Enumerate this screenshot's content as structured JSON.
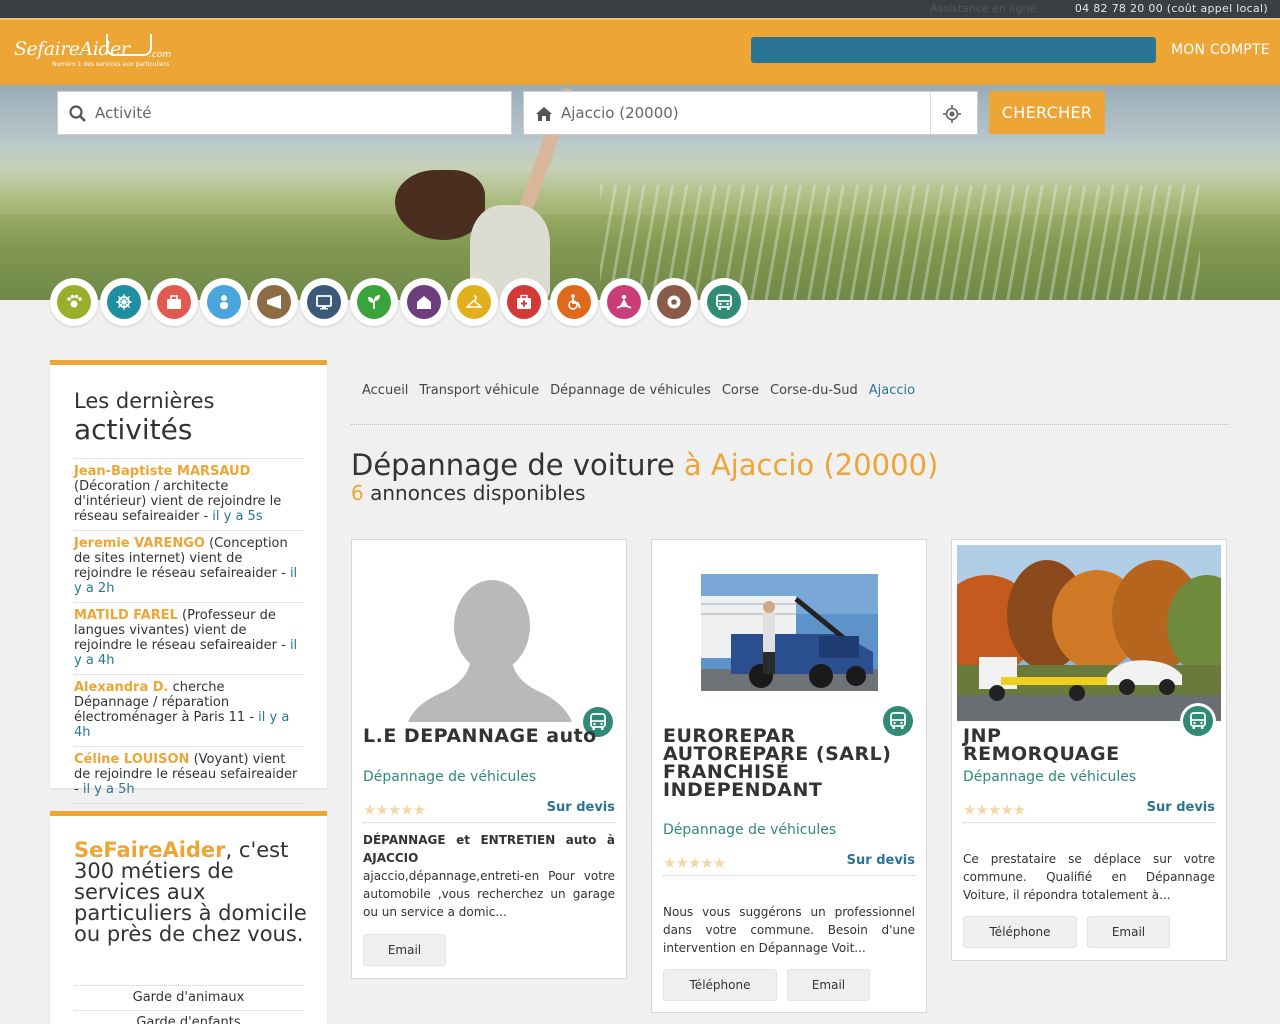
{
  "topbar": {
    "ghost_text": "Assistance en ligne",
    "phone": "04 82 78 20 00 (coût appel local)"
  },
  "header": {
    "logo_text": "SefaireAider",
    "logo_com": ".com",
    "logo_tagline": "Numéro 1 des services aux particuliers",
    "account_label": "MON COMPTE"
  },
  "search": {
    "activity_placeholder": "Activité",
    "city_value": "Ajaccio (20000)",
    "button_label": "CHERCHER"
  },
  "categories": [
    {
      "name": "animaux",
      "color": "#9bae2b",
      "icon": "paw-icon"
    },
    {
      "name": "nautisme",
      "color": "#1d8fa0",
      "icon": "helm-icon"
    },
    {
      "name": "bricolage",
      "color": "#e05a4f",
      "icon": "toolbox-icon"
    },
    {
      "name": "enfants",
      "color": "#4aa5dc",
      "icon": "baby-icon"
    },
    {
      "name": "evenementiel",
      "color": "#8d6b45",
      "icon": "megaphone-icon"
    },
    {
      "name": "informatique",
      "color": "#3b5a7a",
      "icon": "monitor-icon"
    },
    {
      "name": "jardinage",
      "color": "#3aa33a",
      "icon": "plant-icon"
    },
    {
      "name": "menage",
      "color": "#6c3e7e",
      "icon": "house-icon"
    },
    {
      "name": "repassage",
      "color": "#e0b11c",
      "icon": "hanger-icon"
    },
    {
      "name": "sante",
      "color": "#d23a3a",
      "icon": "medkit-icon"
    },
    {
      "name": "handicap",
      "color": "#e06a1c",
      "icon": "wheelchair-icon"
    },
    {
      "name": "bien-etre",
      "color": "#c93e7a",
      "icon": "meditation-icon"
    },
    {
      "name": "sport",
      "color": "#8a5a4a",
      "icon": "ball-icon"
    },
    {
      "name": "transport",
      "color": "#2f8a76",
      "icon": "bus-icon"
    }
  ],
  "sidebar": {
    "title_line1": "Les dernières",
    "title_line2": "activités",
    "activities": [
      {
        "who": "Jean-Baptiste MARSAUD",
        "text": " (Décoration / architecte d'intérieur) vient de rejoindre le réseau sefaireaider - ",
        "when": "il y a 5s"
      },
      {
        "who": "Jeremie VARENGO",
        "text": " (Conception de sites internet) vient de rejoindre le réseau sefaireaider - ",
        "when": "il y a 2h"
      },
      {
        "who": "MATILD FAREL",
        "text": " (Professeur de langues vivantes) vient de rejoindre le réseau sefaireaider - ",
        "when": "il y a 4h"
      },
      {
        "who": "Alexandra D.",
        "text": " cherche Dépannage / réparation électroménager à Paris 11 - ",
        "when": "il y a 4h"
      },
      {
        "who": "Céline LOUISON",
        "text": " (Voyant) vient de rejoindre le réseau sefaireaider - ",
        "when": "il y a 5h"
      }
    ],
    "pitch_brand": "SeFaireAider",
    "pitch_text": ", c'est 300 métiers de services aux particuliers à domicile ou près de chez vous.",
    "cat_links": [
      "Garde d'animaux",
      "Garde d'enfants"
    ]
  },
  "breadcrumb": [
    "Accueil",
    "Transport véhicule",
    "Dépannage de véhicules",
    "Corse",
    "Corse-du-Sud",
    "Ajaccio"
  ],
  "page": {
    "title": "Dépannage de voiture",
    "title_location": "à Ajaccio (20000)",
    "count": "6",
    "count_text": " annonces disponibles"
  },
  "cards": [
    {
      "name": "L.E DEPANNAGE auto",
      "category": "Dépannage de véhicules",
      "stars": "★★★★★",
      "price": "Sur devis",
      "desc_bold": "DÉPANNAGE et ENTRETIEN auto à AJACCIO",
      "desc": "ajaccio,dépannage,entreti-en Pour votre automobile ,vous recherchez un garage ou un service a domic...",
      "buttons": [
        "Email"
      ]
    },
    {
      "name": "EUROREPAR AUTOREPARE (SARL) FRANCHISÉ INDEPENDANT",
      "category": "Dépannage de véhicules",
      "stars": "★★★★★",
      "price": "Sur devis",
      "desc_bold": "",
      "desc": "Nous vous suggérons un professionnel dans votre commune. Besoin d'une intervention en Dépannage Voit...",
      "buttons": [
        "Téléphone",
        "Email"
      ]
    },
    {
      "name": "JNP REMORQUAGE",
      "category": "Dépannage de véhicules",
      "stars": "★★★★★",
      "price": "Sur devis",
      "desc_bold": "",
      "desc": "Ce prestataire se déplace sur votre commune. Qualifié en Dépannage Voiture, il répondra totalement à...",
      "buttons": [
        "Téléphone",
        "Email"
      ]
    }
  ],
  "colors": {
    "brand_orange": "#eda536",
    "brand_blue": "#2a7494",
    "transport_green": "#2f8a76",
    "topbar": "#3a3f44"
  }
}
